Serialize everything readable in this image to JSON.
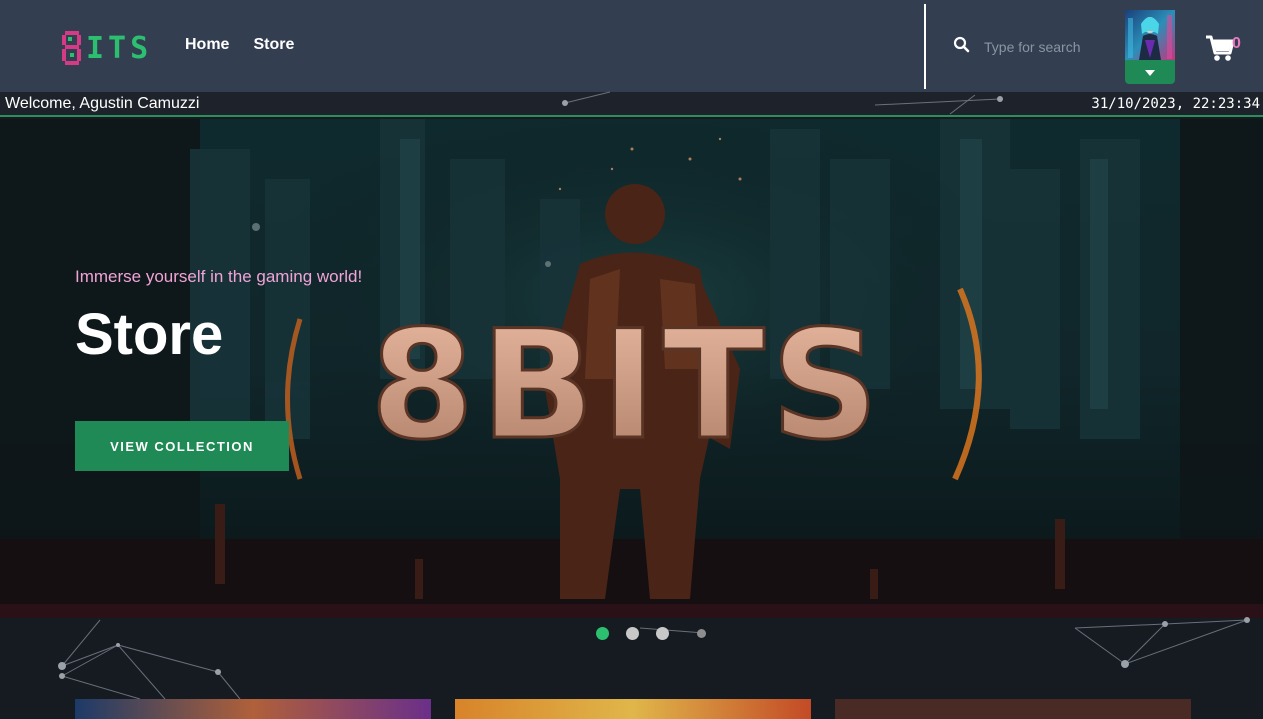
{
  "header": {
    "logo_text": "ITS",
    "logo_mark": "8",
    "nav": [
      {
        "label": "Home"
      },
      {
        "label": "Store"
      }
    ],
    "search_placeholder": "Type for search",
    "cart_count": "0",
    "icons": {
      "search": "search-icon",
      "cart": "cart-icon",
      "dropdown": "caret-down-icon"
    }
  },
  "welcome": {
    "text": "Welcome, Agustin Camuzzi",
    "datetime": "31/10/2023, 22:23:34"
  },
  "hero": {
    "tagline": "Immerse yourself in the gaming world!",
    "title": "Store",
    "button_label": "VIEW COLLECTION",
    "banner_text": "8BITS"
  },
  "carousel": {
    "slides": 4,
    "active": 0
  },
  "colors": {
    "accent": "#1f8a56",
    "header_bg": "#333e50",
    "pink": "#f0a3d6"
  }
}
